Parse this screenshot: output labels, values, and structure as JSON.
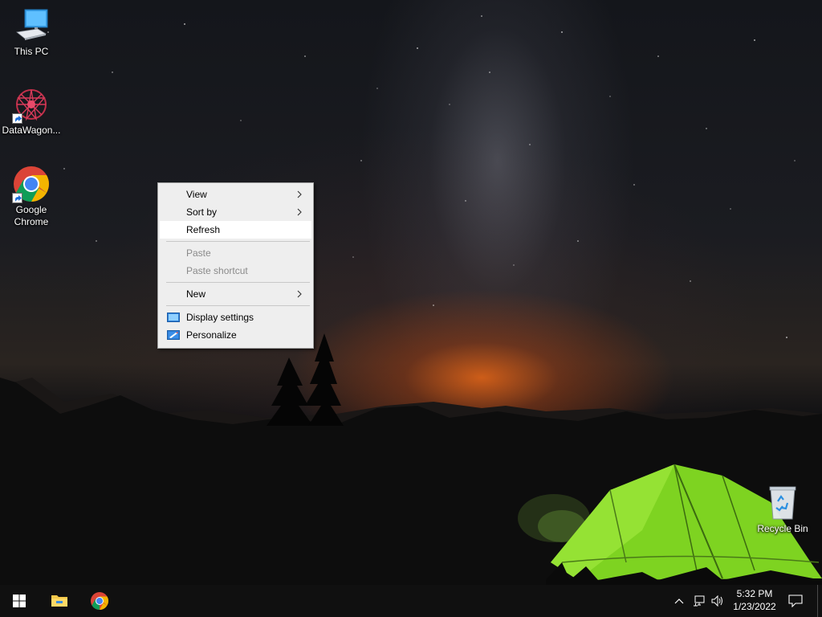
{
  "desktop": {
    "icons": [
      {
        "label": "This PC",
        "icon": "this-pc-icon"
      },
      {
        "label": "DataWagon...",
        "icon": "datawagon-icon"
      },
      {
        "label": "Google Chrome",
        "icon": "chrome-icon"
      },
      {
        "label": "Recycle Bin",
        "icon": "recycle-bin-icon"
      }
    ]
  },
  "context_menu": {
    "items": [
      {
        "label": "View",
        "has_submenu": true,
        "enabled": true
      },
      {
        "label": "Sort by",
        "has_submenu": true,
        "enabled": true
      },
      {
        "label": "Refresh",
        "has_submenu": false,
        "enabled": true,
        "highlighted": true
      },
      {
        "label": "Paste",
        "has_submenu": false,
        "enabled": false
      },
      {
        "label": "Paste shortcut",
        "has_submenu": false,
        "enabled": false
      },
      {
        "label": "New",
        "has_submenu": true,
        "enabled": true
      },
      {
        "label": "Display settings",
        "icon": "display-settings-icon",
        "enabled": true
      },
      {
        "label": "Personalize",
        "icon": "personalize-icon",
        "enabled": true
      }
    ]
  },
  "taskbar": {
    "pinned": [
      {
        "name": "start-button",
        "icon": "windows-logo-icon"
      },
      {
        "name": "file-explorer",
        "icon": "folder-icon"
      },
      {
        "name": "google-chrome",
        "icon": "chrome-icon"
      }
    ],
    "tray": {
      "icons": [
        "chevron-up-icon",
        "network-icon",
        "volume-icon"
      ],
      "time": "5:32 PM",
      "date": "1/23/2022"
    }
  },
  "colors": {
    "menu_bg": "#eeeeee",
    "menu_hover": "#ffffff",
    "taskbar_bg": "#101010",
    "tent_green": "#7ed321"
  }
}
